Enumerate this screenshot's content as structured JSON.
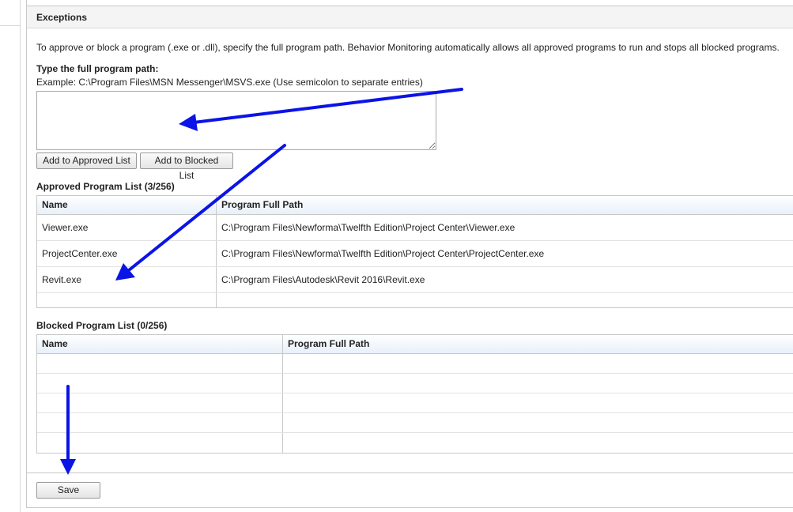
{
  "section": {
    "title": "Exceptions"
  },
  "description": "To approve or block a program (.exe or .dll), specify the full program path. Behavior Monitoring automatically allows all approved programs to run and stops all blocked programs.",
  "path_entry": {
    "label": "Type the full program path:",
    "example": "Example: C:\\Program Files\\MSN Messenger\\MSVS.exe (Use semicolon to separate entries)",
    "value": ""
  },
  "buttons": {
    "approve": "Add to Approved List",
    "block": "Add to Blocked List",
    "save": "Save"
  },
  "approved_list": {
    "title": "Approved Program List",
    "count": "(3/256)",
    "columns": [
      "Name",
      "Program Full Path"
    ],
    "rows": [
      {
        "name": "Viewer.exe",
        "path": "C:\\Program Files\\Newforma\\Twelfth Edition\\Project Center\\Viewer.exe"
      },
      {
        "name": "ProjectCenter.exe",
        "path": "C:\\Program Files\\Newforma\\Twelfth Edition\\Project Center\\ProjectCenter.exe"
      },
      {
        "name": "Revit.exe",
        "path": "C:\\Program Files\\Autodesk\\Revit 2016\\Revit.exe"
      }
    ]
  },
  "blocked_list": {
    "title": "Blocked Program List",
    "count": "(0/256)",
    "columns": [
      "Name",
      "Program Full Path"
    ],
    "rows": []
  },
  "colors": {
    "annotation_arrow": "#0a14e6",
    "header_gradient_end": "#e8f0fa",
    "border": "#c8c8c8"
  }
}
